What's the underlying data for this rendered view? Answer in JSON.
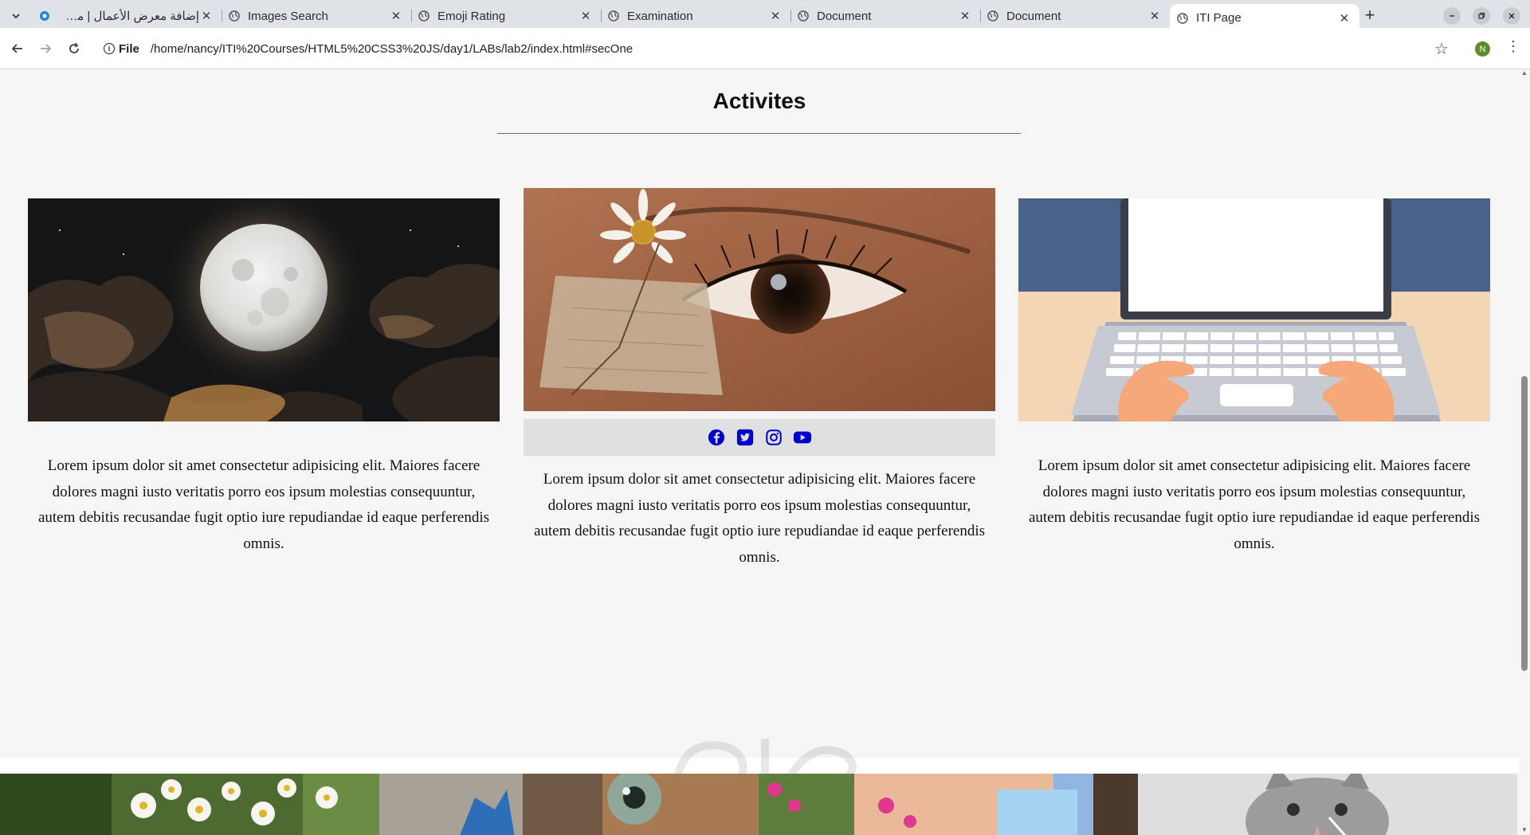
{
  "browser": {
    "tabs": [
      {
        "title": "إضافة معرض الأعمال | مس...",
        "active": false,
        "icon": "mostaql-icon"
      },
      {
        "title": "Images Search",
        "active": false,
        "icon": "globe-icon"
      },
      {
        "title": "Emoji Rating",
        "active": false,
        "icon": "globe-icon"
      },
      {
        "title": "Examination",
        "active": false,
        "icon": "globe-icon"
      },
      {
        "title": "Document",
        "active": false,
        "icon": "globe-icon"
      },
      {
        "title": "Document",
        "active": false,
        "icon": "globe-icon"
      },
      {
        "title": "ITI Page",
        "active": true,
        "icon": "globe-icon"
      }
    ],
    "address": {
      "scheme_label": "File",
      "url": "/home/nancy/ITI%20Courses/HTML5%20CSS3%20JS/day1/LABs/lab2/index.html#secOne"
    },
    "profile_initial": "N"
  },
  "section": {
    "title": "Activites"
  },
  "cards": [
    {
      "image": "full-moon-clouds",
      "text": "Lorem ipsum dolor sit amet consectetur adipisicing elit. Maiores facere dolores magni iusto veritatis porro eos ipsum molestias consequuntur, autem debitis recusandae fugit optio iure repudiandae id eaque perferendis omnis."
    },
    {
      "image": "eye-daisy",
      "text": "Lorem ipsum dolor sit amet consectetur adipisicing elit. Maiores facere dolores magni iusto veritatis porro eos ipsum molestias consequuntur, autem debitis recusandae fugit optio iure repudiandae id eaque perferendis omnis.",
      "social": [
        "facebook-icon",
        "twitter-icon",
        "instagram-icon",
        "youtube-icon"
      ]
    },
    {
      "image": "laptop-typing",
      "text": "Lorem ipsum dolor sit amet consectetur adipisicing elit. Maiores facere dolores magni iusto veritatis porro eos ipsum molestias consequuntur, autem debitis recusandae fugit optio iure repudiandae id eaque perferendis omnis."
    }
  ],
  "colors": {
    "social_icon": "#0000cc",
    "page_bg": "#f5f5f5",
    "social_bar_bg": "#e0e0e0"
  }
}
